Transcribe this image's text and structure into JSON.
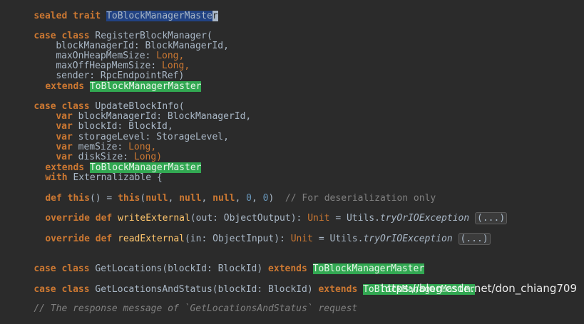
{
  "code": {
    "l1": {
      "kw": "sealed trait ",
      "name": "ToBlockManagerMaste",
      "caret": "r"
    },
    "l2": {
      "kw": "case class ",
      "rest": "RegisterBlockManager("
    },
    "l3": {
      "rest": "blockManagerId: BlockManagerId,"
    },
    "l4": {
      "rest": "maxOnHeapMemSize: ",
      "type": "Long,"
    },
    "l5": {
      "rest": "maxOffHeapMemSize: ",
      "type": "Long,"
    },
    "l6": {
      "rest": "sender: RpcEndpointRef)"
    },
    "l7": {
      "kw": "extends ",
      "name": "ToBlockManagerMaster"
    },
    "l8": {
      "kw": "case class ",
      "rest": "UpdateBlockInfo("
    },
    "l9": {
      "kw": "var ",
      "rest": "blockManagerId: BlockManagerId,"
    },
    "l10": {
      "kw": "var ",
      "rest": "blockId: BlockId,"
    },
    "l11": {
      "kw": "var ",
      "rest": "storageLevel: StorageLevel,"
    },
    "l12": {
      "kw": "var ",
      "rest": "memSize: ",
      "type": "Long,"
    },
    "l13": {
      "kw": "var ",
      "rest": "diskSize: ",
      "type": "Long)"
    },
    "l14": {
      "kw": "extends ",
      "name": "ToBlockManagerMaster"
    },
    "l15": {
      "kw": "with ",
      "rest": "Externalizable {"
    },
    "l16": {
      "kw1": "def ",
      "kw2": "this",
      "mid": "() = ",
      "kw3": "this",
      "open": "(",
      "n1": "null",
      "c1": ", ",
      "n2": "null",
      "c2": ", ",
      "n3": "null",
      "c3": ", ",
      "z1": "0",
      "c4": ", ",
      "z2": "0",
      "close": ")  ",
      "comment": "// For deserialization only"
    },
    "l17": {
      "kw": "override def ",
      "fn": "writeExternal",
      "args": "(out: ObjectOutput): ",
      "ret": "Unit",
      "eq": " = Utils.",
      "call": "tryOrIOException",
      "fold": "(...)"
    },
    "l18": {
      "kw": "override def ",
      "fn": "readExternal",
      "args": "(in: ObjectInput): ",
      "ret": "Unit",
      "eq": " = Utils.",
      "call": "tryOrIOException",
      "fold": "(...)"
    },
    "l19": {
      "kw": "case class ",
      "rest": "GetLocations(blockId: BlockId) ",
      "kw2": "extends ",
      "name": "ToBlockManagerMaster"
    },
    "l20": {
      "kw": "case class ",
      "rest": "GetLocationsAndStatus(blockId: BlockId) ",
      "kw2": "extends ",
      "name": "ToBlockManagerMaster"
    },
    "l21": {
      "comment": "// The response message of `GetLocationsAndStatus` request"
    }
  },
  "watermark": "https://blog.csdn.net/don_chiang709",
  "colors": {
    "background": "#2b2b2b",
    "keyword": "#cc7832",
    "number": "#6897bb",
    "comment": "#808080",
    "highlight_green": "#32a852",
    "highlight_blue": "#214283"
  }
}
